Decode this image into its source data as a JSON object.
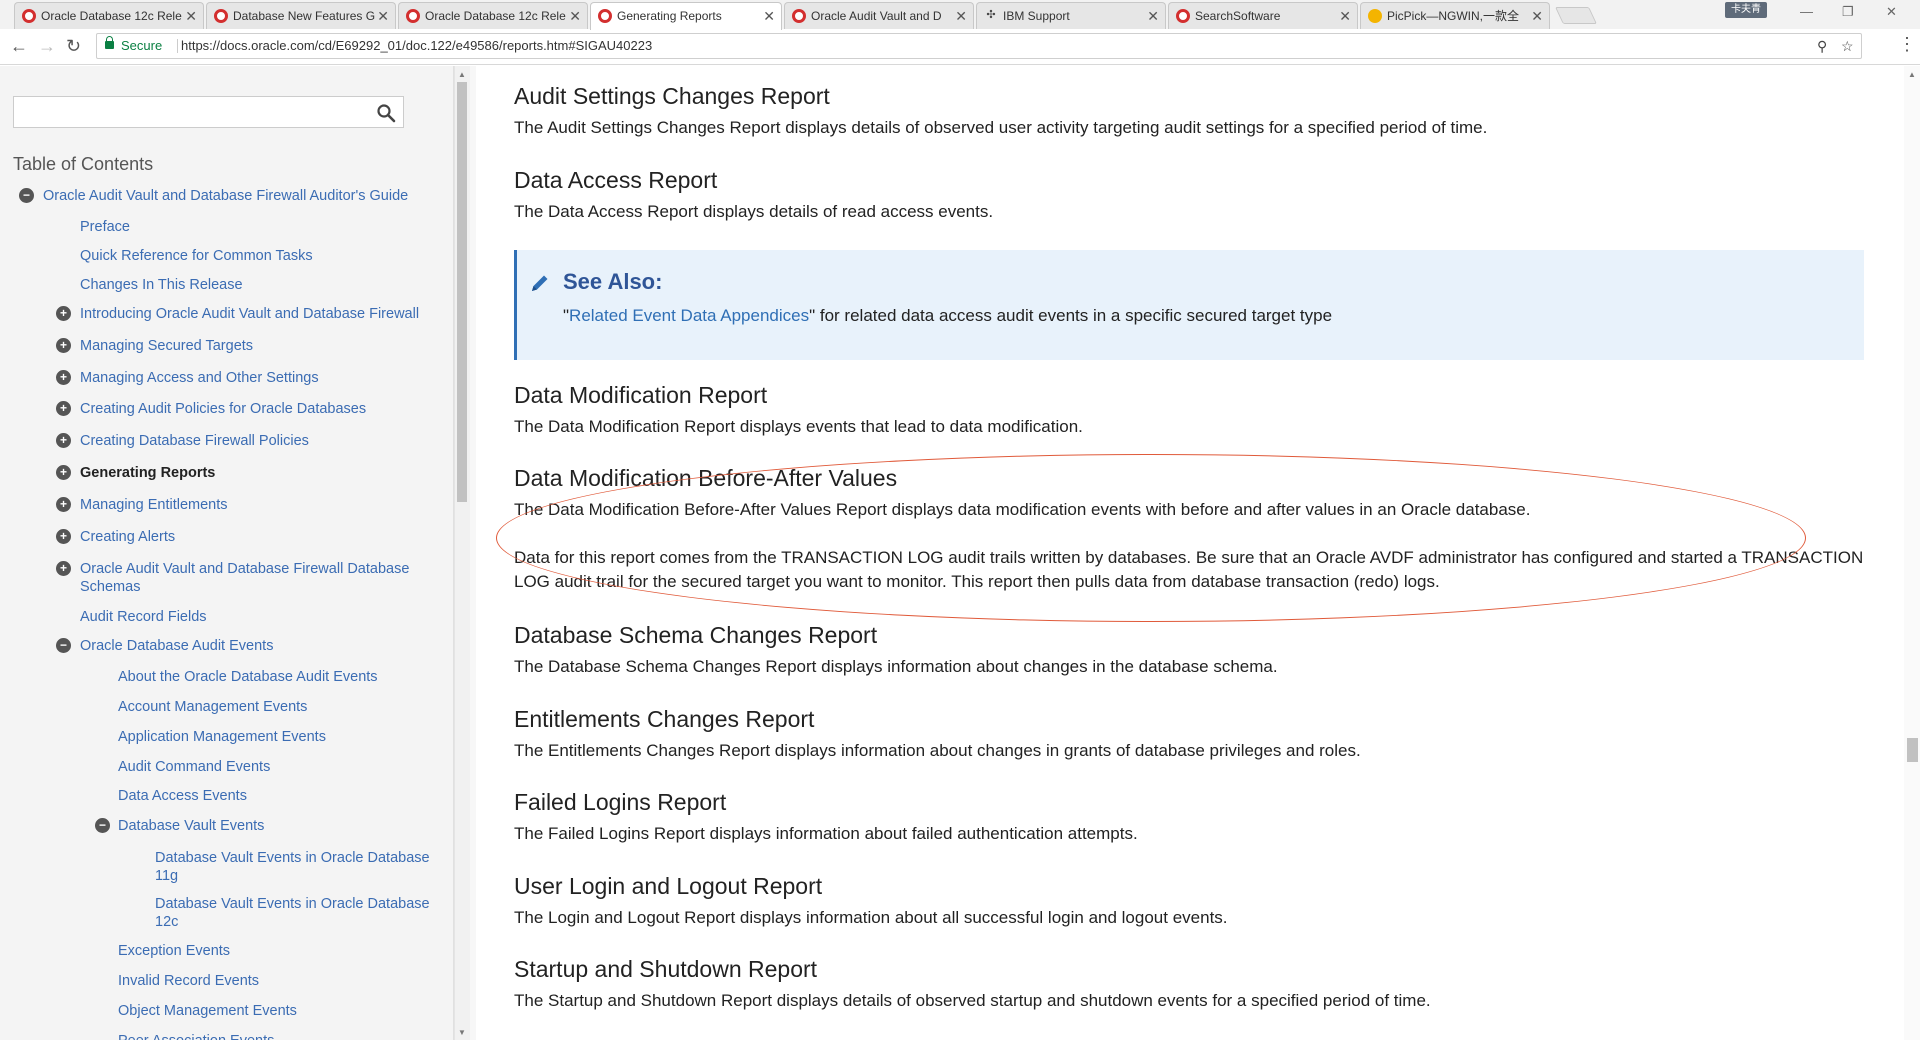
{
  "browser": {
    "tabs": [
      {
        "title": "Oracle Database 12c Rele",
        "icon": "oracle-icon"
      },
      {
        "title": "Database New Features G",
        "icon": "oracle-icon"
      },
      {
        "title": "Oracle Database 12c Rele",
        "icon": "oracle-icon"
      },
      {
        "title": "Generating Reports",
        "icon": "oracle-icon",
        "active": true
      },
      {
        "title": "Oracle Audit Vault and D",
        "icon": "oracle-icon"
      },
      {
        "title": "IBM Support",
        "icon": "ibm-icon"
      },
      {
        "title": "SearchSoftware",
        "icon": "oracle-icon"
      },
      {
        "title": "PicPick—NGWIN,一款全",
        "icon": "picpick-icon"
      }
    ],
    "tab_close": "✕",
    "profile_label": "卡夫青",
    "secure_label": "Secure",
    "url": "https://docs.oracle.com/cd/E69292_01/doc.122/e49586/reports.htm#SIGAU40223",
    "colors": {
      "secure": "#0b8043",
      "link": "#3b6cb3",
      "note_bg": "#e8f2fb",
      "annotation": "#e05a3a"
    }
  },
  "sidebar": {
    "search_placeholder": "",
    "toc_title": "Table of Contents",
    "items": [
      {
        "label": "Oracle Audit Vault and Database Firewall Auditor's Guide",
        "toggle": "−"
      },
      {
        "label": "Preface"
      },
      {
        "label": "Quick Reference for Common Tasks"
      },
      {
        "label": "Changes In This Release"
      },
      {
        "label": "Introducing Oracle Audit Vault and Database Firewall",
        "toggle": "+"
      },
      {
        "label": "Managing Secured Targets",
        "toggle": "+"
      },
      {
        "label": "Managing Access and Other Settings",
        "toggle": "+"
      },
      {
        "label": "Creating Audit Policies for Oracle Databases",
        "toggle": "+"
      },
      {
        "label": "Creating Database Firewall Policies",
        "toggle": "+"
      },
      {
        "label": "Generating Reports",
        "toggle": "+",
        "current": true
      },
      {
        "label": "Managing Entitlements",
        "toggle": "+"
      },
      {
        "label": "Creating Alerts",
        "toggle": "+"
      },
      {
        "label": "Oracle Audit Vault and Database Firewall Database Schemas",
        "toggle": "+"
      },
      {
        "label": "Audit Record Fields"
      },
      {
        "label": "Oracle Database Audit Events",
        "toggle": "−"
      },
      {
        "label": "About the Oracle Database Audit Events"
      },
      {
        "label": "Account Management Events"
      },
      {
        "label": "Application Management Events"
      },
      {
        "label": "Audit Command Events"
      },
      {
        "label": "Data Access Events"
      },
      {
        "label": "Database Vault Events",
        "toggle": "−"
      },
      {
        "label": "Database Vault Events in Oracle Database 11g"
      },
      {
        "label": "Database Vault Events in Oracle Database 12c"
      },
      {
        "label": "Exception Events"
      },
      {
        "label": "Invalid Record Events"
      },
      {
        "label": "Object Management Events"
      },
      {
        "label": "Peer Association Events"
      }
    ]
  },
  "main": {
    "sections": [
      {
        "title": "Audit Settings Changes Report",
        "body": "The Audit Settings Changes Report displays details of observed user activity targeting audit settings for a specified period of time."
      },
      {
        "title": "Data Access Report",
        "body": "The Data Access Report displays details of read access events."
      },
      {
        "title": "Data Modification Report",
        "body": "The Data Modification Report displays events that lead to data modification."
      },
      {
        "title": "Data Modification Before-After Values",
        "body": "The Data Modification Before-After Values Report displays data modification events with before and after values in an Oracle database.",
        "body2": "Data for this report comes from the TRANSACTION LOG audit trails written by databases. Be sure that an Oracle AVDF administrator has configured and started a TRANSACTION LOG audit trail for the secured target you want to monitor. This report then pulls data from database transaction (redo) logs."
      },
      {
        "title": "Database Schema Changes Report",
        "body": "The Database Schema Changes Report displays information about changes in the database schema."
      },
      {
        "title": "Entitlements Changes Report",
        "body": "The Entitlements Changes Report displays information about changes in grants of database privileges and roles."
      },
      {
        "title": "Failed Logins Report",
        "body": "The Failed Logins Report displays information about failed authentication attempts."
      },
      {
        "title": "User Login and Logout Report",
        "body": "The Login and Logout Report displays information about all successful login and logout events."
      },
      {
        "title": "Startup and Shutdown Report",
        "body": "The Startup and Shutdown Report displays details of observed startup and shutdown events for a specified period of time."
      }
    ],
    "note": {
      "title": "See Also:",
      "open_quote": "\"",
      "link": "Related Event Data Appendices",
      "rest": "\" for related data access audit events in a specific secured target type"
    }
  }
}
